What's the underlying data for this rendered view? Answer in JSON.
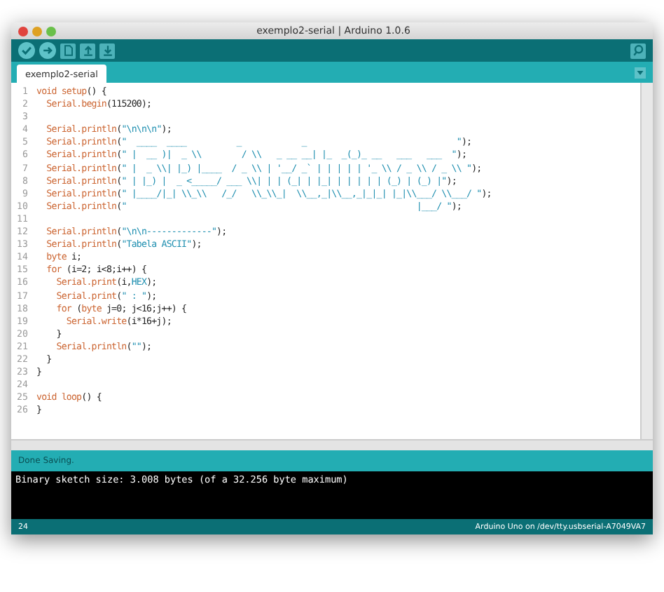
{
  "window": {
    "title": "exemplo2-serial | Arduino 1.0.6"
  },
  "toolbar": {
    "buttons": [
      {
        "kind": "verify"
      },
      {
        "kind": "upload"
      },
      {
        "kind": "new"
      },
      {
        "kind": "open"
      },
      {
        "kind": "save"
      }
    ]
  },
  "tabs": [
    {
      "label": "exemplo2-serial",
      "selected": true
    }
  ],
  "editor": {
    "lines": [
      {
        "num": "1",
        "tokens": [
          {
            "kind": "keyword",
            "text": "void setup"
          },
          {
            "kind": "plain",
            "text": "() {"
          }
        ]
      },
      {
        "num": "2",
        "tokens": [
          {
            "kind": "keyword",
            "text": "  Serial.begin"
          },
          {
            "kind": "plain",
            "text": "(115200);"
          }
        ]
      },
      {
        "num": "3"
      },
      {
        "num": "4",
        "tokens": [
          {
            "kind": "keyword",
            "text": "  Serial.println"
          },
          {
            "kind": "plain",
            "text": "("
          },
          {
            "kind": "string",
            "text": "\"\\n\\n\\n\""
          },
          {
            "kind": "plain",
            "text": ");"
          }
        ]
      },
      {
        "num": "5",
        "tokens": [
          {
            "kind": "keyword",
            "text": "  Serial.println"
          },
          {
            "kind": "plain",
            "text": "("
          },
          {
            "kind": "string",
            "text": "\"  ____  ____          _            _                              \""
          },
          {
            "kind": "plain",
            "text": ");"
          }
        ]
      },
      {
        "num": "6",
        "tokens": [
          {
            "kind": "keyword",
            "text": "  Serial.println"
          },
          {
            "kind": "plain",
            "text": "("
          },
          {
            "kind": "string",
            "text": "\" |  __ )|  _ \\\\        / \\\\   _ __ __| |_  _(_)_ __   ___   ___  \""
          },
          {
            "kind": "plain",
            "text": ");"
          }
        ]
      },
      {
        "num": "7",
        "tokens": [
          {
            "kind": "keyword",
            "text": "  Serial.println"
          },
          {
            "kind": "plain",
            "text": "("
          },
          {
            "kind": "string",
            "text": "\" |  _ \\\\| |_) |____  / _ \\\\ | '__/ _` | | | | | '_ \\\\ / _ \\\\ / _ \\\\ \""
          },
          {
            "kind": "plain",
            "text": ");"
          }
        ]
      },
      {
        "num": "8",
        "tokens": [
          {
            "kind": "keyword",
            "text": "  Serial.println"
          },
          {
            "kind": "plain",
            "text": "("
          },
          {
            "kind": "string",
            "text": "\" | |_) |  _ <_____/ ___ \\\\| | | (_| | |_| | | | | | (_) | (_) |\""
          },
          {
            "kind": "plain",
            "text": ");"
          }
        ]
      },
      {
        "num": "9",
        "tokens": [
          {
            "kind": "keyword",
            "text": "  Serial.println"
          },
          {
            "kind": "plain",
            "text": "("
          },
          {
            "kind": "string",
            "text": "\" |____/|_| \\\\_\\\\   /_/   \\\\_\\\\_|  \\\\__,_|\\\\__,_|_|_| |_|\\\\___/ \\\\___/ \""
          },
          {
            "kind": "plain",
            "text": ");"
          }
        ]
      },
      {
        "num": "10",
        "tokens": [
          {
            "kind": "keyword",
            "text": "  Serial.println"
          },
          {
            "kind": "plain",
            "text": "("
          },
          {
            "kind": "string",
            "text": "\"                                                          |___/ \""
          },
          {
            "kind": "plain",
            "text": ");"
          }
        ]
      },
      {
        "num": "11"
      },
      {
        "num": "12",
        "tokens": [
          {
            "kind": "keyword",
            "text": "  Serial.println"
          },
          {
            "kind": "plain",
            "text": "("
          },
          {
            "kind": "string",
            "text": "\"\\n\\n-------------\""
          },
          {
            "kind": "plain",
            "text": ");"
          }
        ]
      },
      {
        "num": "13",
        "tokens": [
          {
            "kind": "keyword",
            "text": "  Serial.println"
          },
          {
            "kind": "plain",
            "text": "("
          },
          {
            "kind": "string",
            "text": "\"Tabela ASCII\""
          },
          {
            "kind": "plain",
            "text": ");"
          }
        ]
      },
      {
        "num": "14",
        "tokens": [
          {
            "kind": "keyword",
            "text": "  byte"
          },
          {
            "kind": "plain",
            "text": " i;"
          }
        ]
      },
      {
        "num": "15",
        "tokens": [
          {
            "kind": "keyword",
            "text": "  for"
          },
          {
            "kind": "plain",
            "text": " (i=2; i<8;i++) {"
          }
        ]
      },
      {
        "num": "16",
        "tokens": [
          {
            "kind": "keyword",
            "text": "    Serial.print"
          },
          {
            "kind": "plain",
            "text": "(i,"
          },
          {
            "kind": "string",
            "text": "HEX"
          },
          {
            "kind": "plain",
            "text": ");"
          }
        ]
      },
      {
        "num": "17",
        "tokens": [
          {
            "kind": "keyword",
            "text": "    Serial.print"
          },
          {
            "kind": "plain",
            "text": "("
          },
          {
            "kind": "string",
            "text": "\" : \""
          },
          {
            "kind": "plain",
            "text": ");"
          }
        ]
      },
      {
        "num": "18",
        "tokens": [
          {
            "kind": "keyword",
            "text": "    for"
          },
          {
            "kind": "plain",
            "text": " ("
          },
          {
            "kind": "keyword",
            "text": "byte"
          },
          {
            "kind": "plain",
            "text": " j=0; j<16;j++) {"
          }
        ]
      },
      {
        "num": "19",
        "tokens": [
          {
            "kind": "keyword",
            "text": "      Serial.write"
          },
          {
            "kind": "plain",
            "text": "(i*16+j);"
          }
        ]
      },
      {
        "num": "20",
        "tokens": [
          {
            "kind": "plain",
            "text": "    }"
          }
        ]
      },
      {
        "num": "21",
        "tokens": [
          {
            "kind": "keyword",
            "text": "    Serial.println"
          },
          {
            "kind": "plain",
            "text": "("
          },
          {
            "kind": "string",
            "text": "\"\""
          },
          {
            "kind": "plain",
            "text": ");"
          }
        ]
      },
      {
        "num": "22",
        "tokens": [
          {
            "kind": "plain",
            "text": "  }"
          }
        ]
      },
      {
        "num": "23",
        "tokens": [
          {
            "kind": "plain",
            "text": "}"
          }
        ]
      },
      {
        "num": "24"
      },
      {
        "num": "25",
        "tokens": [
          {
            "kind": "keyword",
            "text": "void loop"
          },
          {
            "kind": "plain",
            "text": "() {"
          }
        ]
      },
      {
        "num": "26",
        "tokens": [
          {
            "kind": "plain",
            "text": "}"
          }
        ]
      }
    ]
  },
  "status": {
    "message": "Done Saving."
  },
  "console": {
    "lines": [
      "Binary sketch size: 3.008 bytes (of a 32.256 byte maximum)"
    ]
  },
  "status_bar": {
    "line": "24",
    "board": "Arduino Uno on /dev/tty.usbserial-A7049VA7"
  }
}
